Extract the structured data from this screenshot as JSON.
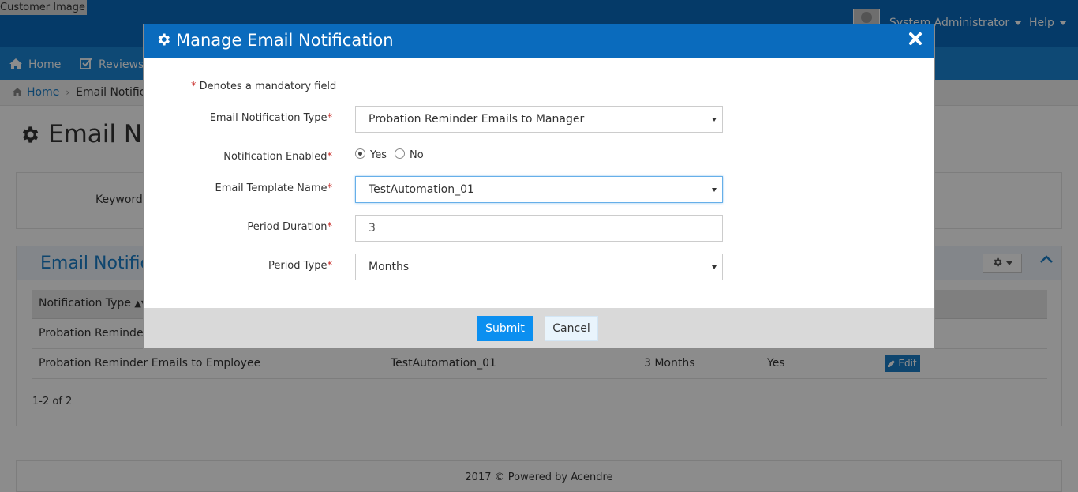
{
  "topbar": {
    "customer_image": "Customer Image",
    "user_name": "System Administrator",
    "help": "Help"
  },
  "nav": {
    "home": "Home",
    "reviews": "Reviews"
  },
  "breadcrumb": {
    "home": "Home",
    "current": "Email Notificat"
  },
  "page": {
    "title": "Email No"
  },
  "search": {
    "keyword_label": "Keyword"
  },
  "list": {
    "title": "Email Notifica",
    "column_type": "Notification Type",
    "rows": [
      {
        "type": "Probation Reminder E"
      },
      {
        "type": "Probation Reminder Emails to Employee",
        "template": "TestAutomation_01",
        "period": "3 Months",
        "enabled": "Yes",
        "action": "Edit"
      }
    ],
    "pager": "1-2 of 2"
  },
  "footer": {
    "text": "2017 © Powered by Acendre"
  },
  "modal": {
    "title": "Manage Email Notification",
    "mandatory_star": "*",
    "mandatory_note": "Denotes a mandatory field",
    "fields": {
      "notification_type": {
        "label": "Email Notification Type",
        "value": "Probation Reminder Emails to Manager"
      },
      "enabled": {
        "label": "Notification Enabled",
        "options": [
          "Yes",
          "No"
        ],
        "selected": "Yes"
      },
      "template": {
        "label": "Email Template Name",
        "value": "TestAutomation_01"
      },
      "duration": {
        "label": "Period Duration",
        "value": "3"
      },
      "period_type": {
        "label": "Period Type",
        "value": "Months"
      }
    },
    "submit": "Submit",
    "cancel": "Cancel"
  },
  "colors": {
    "header_blue": "#0a6bbd",
    "nav_blue": "#1a86d6",
    "submit_blue": "#0b8ff0",
    "required_red": "#c9302c"
  },
  "icons": [
    "gear-icon",
    "close-icon",
    "home-icon",
    "reviews-icon",
    "sort-icon",
    "pencil-icon",
    "chevron-up-icon"
  ]
}
